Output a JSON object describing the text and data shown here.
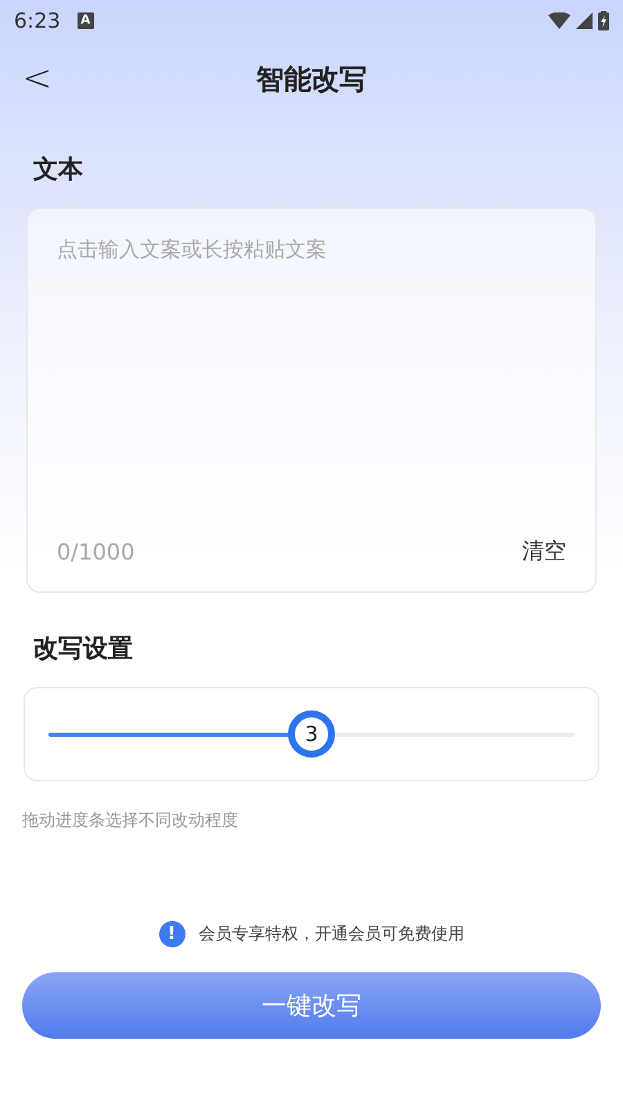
{
  "status_bar": {
    "time": "6:23",
    "notification": "A"
  },
  "header": {
    "back": "<",
    "title": "智能改写"
  },
  "text_section": {
    "label": "文本",
    "placeholder": "点击输入文案或长按粘贴文案",
    "counter": "0/1000",
    "clear": "清空"
  },
  "settings": {
    "label": "改写设置",
    "slider": {
      "level": 0.5,
      "value": "3"
    },
    "hint": "拖动进度条选择不同改动程度"
  },
  "notice": {
    "icon": "!",
    "text": "会员专享特权，开通会员可免费使用"
  },
  "button": {
    "label": "一键改写"
  }
}
